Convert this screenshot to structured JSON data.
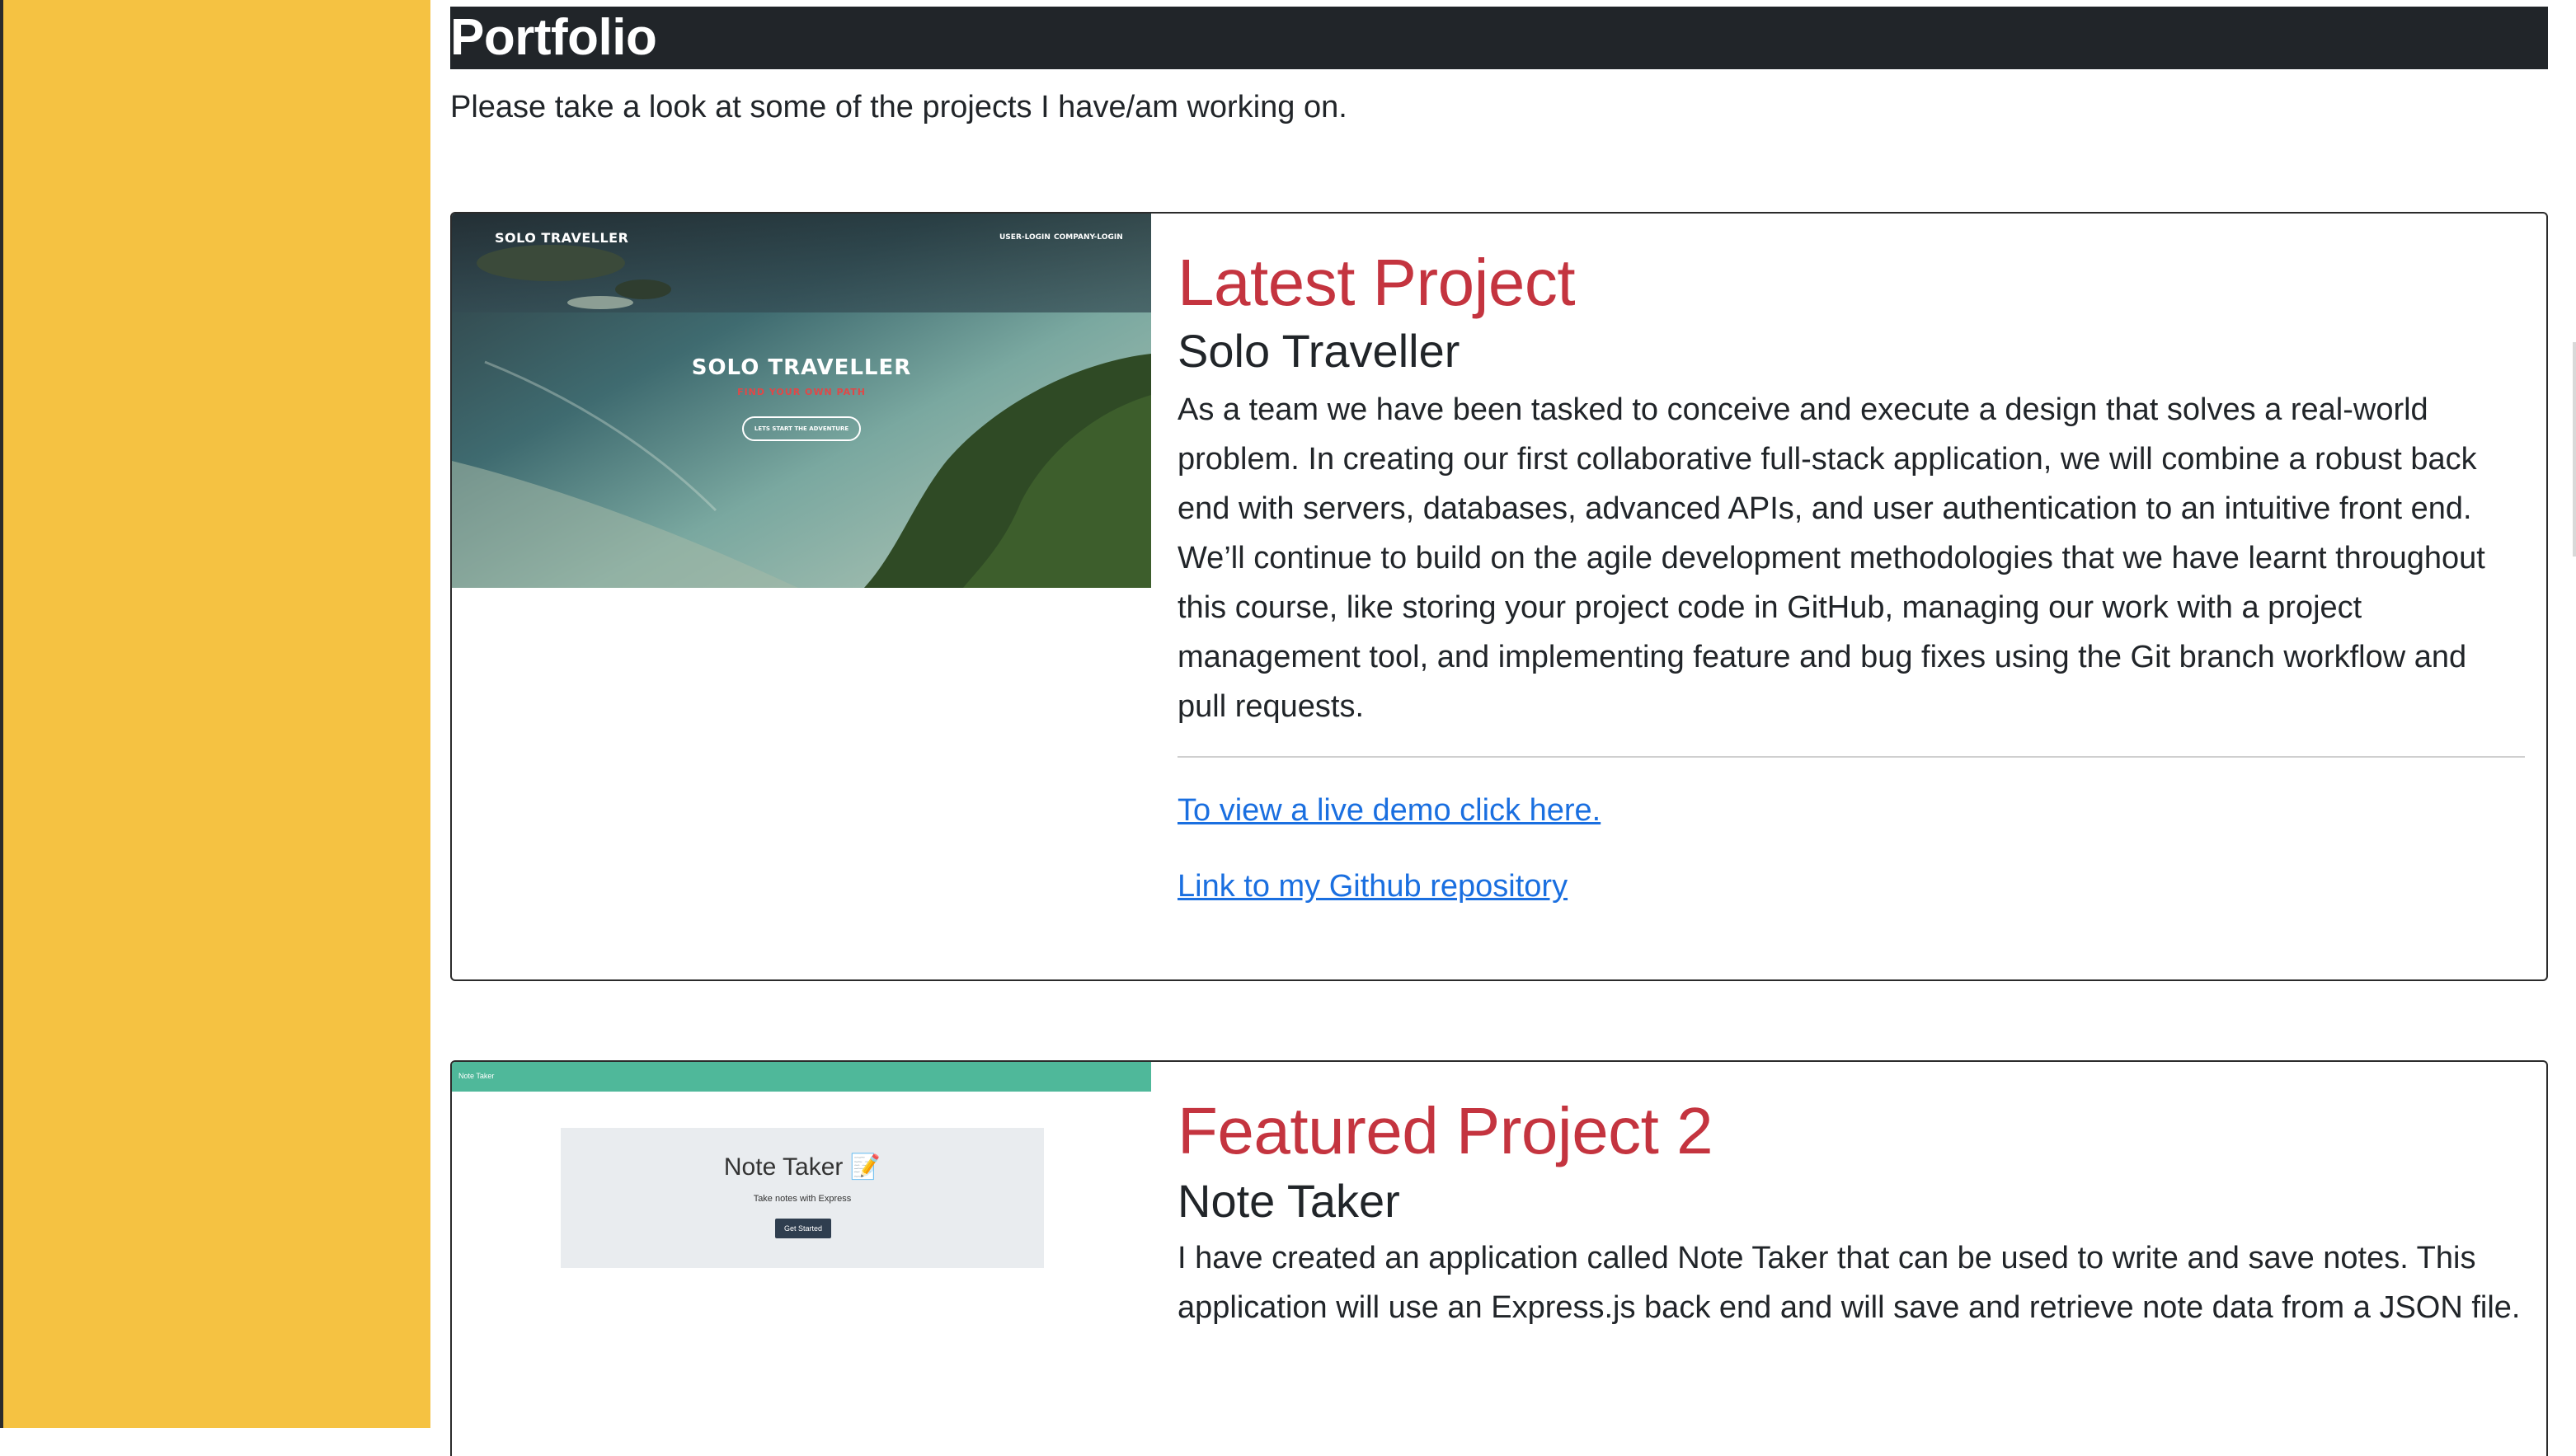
{
  "portfolio": {
    "title": "Portfolio",
    "intro": "Please take a look at some of the projects I have/am working on."
  },
  "projects": [
    {
      "eyebrow": "Latest Project",
      "name": "Solo Traveller",
      "description": "As a team we have been tasked to conceive and execute a design that solves a real-world problem. In creating our first collaborative full-stack application, we will combine a robust back end with servers, databases, advanced APIs, and user authentication to an intuitive front end. We’ll continue to build on the agile development methodologies that we have learnt throughout this course, like storing your project code in GitHub, managing our work with a project management tool, and implementing feature and bug fixes using the Git branch workflow and pull requests.",
      "demo_link": "To view a live demo click here.",
      "repo_link": "Link to my Github repository",
      "thumbnail": {
        "logo": "SOLO TRAVELLER",
        "nav": [
          "USER-LOGIN",
          "COMPANY-LOGIN"
        ],
        "hero": "SOLO TRAVELLER",
        "tagline": "FIND YOUR OWN PATH",
        "button": "LETS START THE ADVENTURE"
      }
    },
    {
      "eyebrow": "Featured Project 2",
      "name": "Note Taker",
      "description": "I have created an application called Note Taker that can be used to write and save notes. This application will use an Express.js back end and will save and retrieve note data from a JSON file.",
      "thumbnail": {
        "bar_label": "Note Taker",
        "title": "Note Taker 📝",
        "subtitle": "Take notes with Express",
        "button": "Get Started"
      }
    }
  ],
  "colors": {
    "sidebar": "#f5c242",
    "accent": "#c4343f",
    "link": "#1a6fe0",
    "title_bar": "#212529",
    "note_bar": "#4fb89a"
  }
}
